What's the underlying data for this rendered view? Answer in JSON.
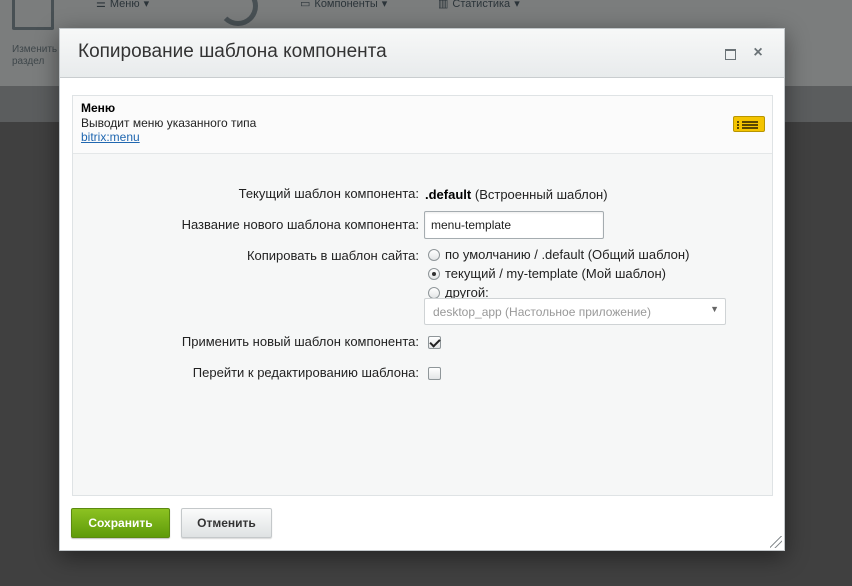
{
  "background": {
    "menu_label": "Меню",
    "components_label": "Компоненты",
    "statistics_label": "Статистика",
    "side_label_line1": "Изменить",
    "side_label_line2": "раздел"
  },
  "dialog": {
    "title": "Копирование шаблона компонента",
    "component": {
      "name": "Меню",
      "description": "Выводит меню указанного типа",
      "code": "bitrix:menu"
    },
    "form": {
      "current_template_label": "Текущий шаблон компонента:",
      "current_template_value": ".default",
      "current_template_note": "(Встроенный шаблон)",
      "new_template_label": "Название нового шаблона компонента:",
      "new_template_value": "menu-template",
      "copy_to_label": "Копировать в шаблон сайта:",
      "copy_options": [
        {
          "label": "по умолчанию / .default (Общий шаблон)",
          "checked": false
        },
        {
          "label": "текущий / my-template (Мой шаблон)",
          "checked": true
        },
        {
          "label": "другой:",
          "checked": false
        }
      ],
      "other_select_value": "desktop_app (Настольное приложение)",
      "apply_label": "Применить новый шаблон компонента:",
      "apply_checked": true,
      "edit_label": "Перейти к редактированию шаблона:",
      "edit_checked": false
    },
    "buttons": {
      "save": "Сохранить",
      "cancel": "Отменить"
    }
  }
}
